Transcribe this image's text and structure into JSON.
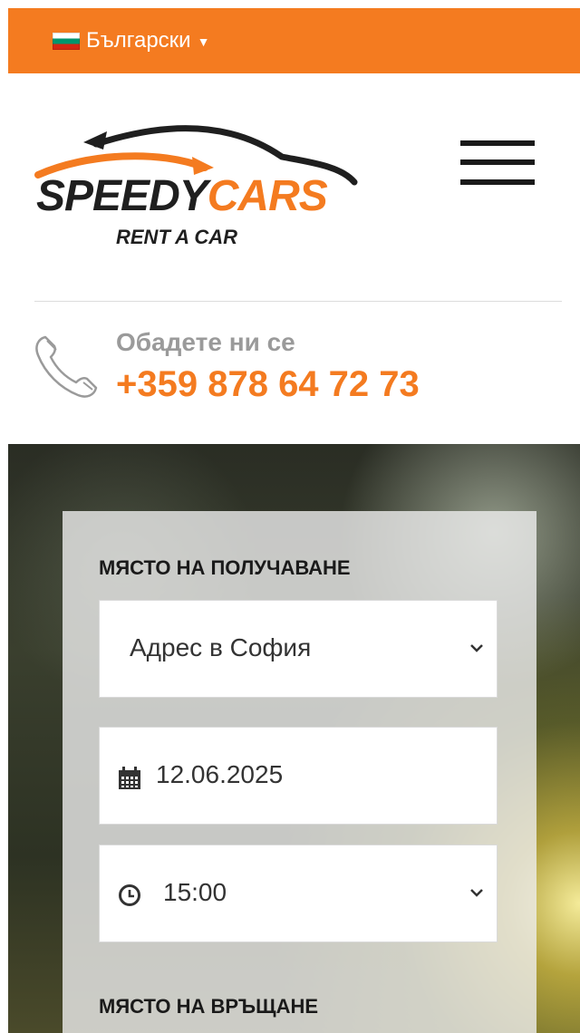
{
  "topbar": {
    "language": "Български",
    "color": "#f47b20"
  },
  "logo": {
    "word_primary": "SPEEDY",
    "word_accent": "CARS",
    "tagline": "RENT A CAR",
    "accent_color": "#f47b20"
  },
  "header": {
    "menu_icon": "hamburger-icon"
  },
  "contact": {
    "label": "Обадете ни се",
    "phone": "+359 878 64 72 73",
    "icon": "phone-icon"
  },
  "booking": {
    "pickup_label": "МЯСТО НА ПОЛУЧАВАНЕ",
    "pickup_location": "Адрес в София",
    "pickup_date": "12.06.2025",
    "pickup_time": "15:00",
    "return_label": "МЯСТО НА ВРЪЩАНЕ"
  }
}
